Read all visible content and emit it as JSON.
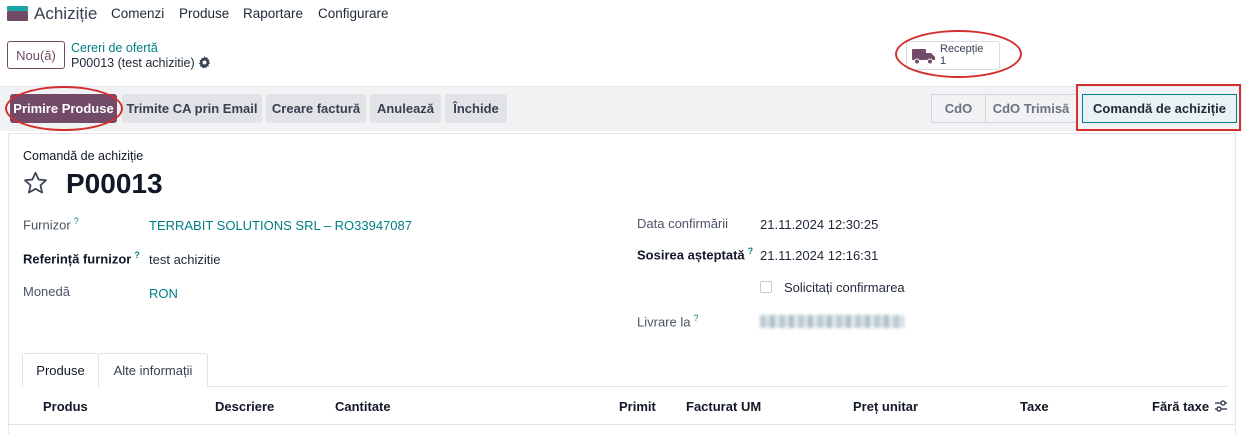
{
  "navbar": {
    "app_name": "Achiziție",
    "menu": [
      "Comenzi",
      "Produse",
      "Raportare",
      "Configurare"
    ]
  },
  "control": {
    "new_label": "Nou(ă)",
    "breadcrumb_parent": "Cereri de ofertă",
    "breadcrumb_current": "P00013 (test achizitie)",
    "smart_button": {
      "label": "Recepție",
      "count": "1"
    }
  },
  "actions": [
    "Primire Produse",
    "Trimite CA prin Email",
    "Creare factură",
    "Anulează",
    "Închide"
  ],
  "stages": [
    "CdO",
    "CdO Trimisă",
    "Comandă de achiziție"
  ],
  "form": {
    "record_type": "Comandă de achiziție",
    "name": "P00013",
    "supplier_label": "Furnizor",
    "supplier_value": "TERRABIT SOLUTIONS SRL – RO33947087",
    "ref_label": "Referință furnizor",
    "ref_value": "test achizitie",
    "currency_label": "Monedă",
    "currency_value": "RON",
    "confirm_label": "Data confirmării",
    "confirm_value": "21.11.2024 12:30:25",
    "arrival_label": "Sosirea așteptată",
    "arrival_value": "21.11.2024 12:16:31",
    "ask_confirm_label": "Solicitați confirmarea",
    "deliver_label": "Livrare la",
    "help_mark": "?"
  },
  "tabs": [
    "Produse",
    "Alte informații"
  ],
  "table": {
    "headers": [
      "Produs",
      "Descriere",
      "Cantitate",
      "Primit",
      "Facturat",
      "UM",
      "Preț unitar",
      "Taxe",
      "Fără taxe"
    ]
  },
  "colors": {
    "brand": "#714b67",
    "link": "#017e84",
    "highlight": "#d32f2f"
  }
}
